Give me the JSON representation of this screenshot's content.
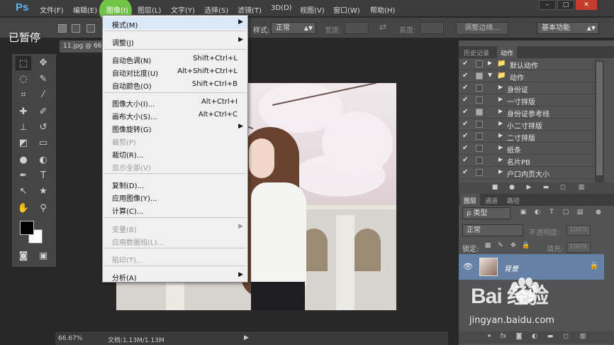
{
  "watermark_paused": "已暂停",
  "menubar": {
    "logo": "Ps",
    "items": [
      "文件(F)",
      "编辑(E)",
      "图像(I)",
      "图层(L)",
      "文字(Y)",
      "选择(S)",
      "滤镜(T)",
      "3D(D)",
      "视图(V)",
      "窗口(W)",
      "帮助(H)"
    ],
    "window_buttons": [
      "–",
      "□",
      "✕"
    ]
  },
  "options": {
    "style_label": "样式:",
    "style_value": "正常",
    "width_label": "宽度:",
    "height_label": "高度:",
    "refine_button": "调整边缘...",
    "workspace": "基本功能"
  },
  "document": {
    "tab_title": "11.jpg @ 66",
    "zoom": "66.67%",
    "doc_size": "文档:1.13M/1.13M",
    "status_arrow": "▶"
  },
  "image_menu": {
    "items": [
      {
        "label": "模式(M)",
        "shortcut": "",
        "submenu": true,
        "disabled": false,
        "highlight": true
      },
      {
        "label": "调整(J)",
        "shortcut": "",
        "submenu": true,
        "disabled": false
      },
      {
        "label": "自动色调(N)",
        "shortcut": "Shift+Ctrl+L",
        "disabled": false
      },
      {
        "label": "自动对比度(U)",
        "shortcut": "Alt+Shift+Ctrl+L",
        "disabled": false
      },
      {
        "label": "自动颜色(O)",
        "shortcut": "Shift+Ctrl+B",
        "disabled": false
      },
      {
        "label": "图像大小(I)...",
        "shortcut": "Alt+Ctrl+I",
        "disabled": false
      },
      {
        "label": "画布大小(S)...",
        "shortcut": "Alt+Ctrl+C",
        "disabled": false
      },
      {
        "label": "图像旋转(G)",
        "shortcut": "",
        "submenu": true,
        "disabled": false
      },
      {
        "label": "裁剪(P)",
        "shortcut": "",
        "disabled": true
      },
      {
        "label": "裁切(R)...",
        "shortcut": "",
        "disabled": false
      },
      {
        "label": "显示全部(V)",
        "shortcut": "",
        "disabled": true
      },
      {
        "label": "复制(D)...",
        "shortcut": "",
        "disabled": false
      },
      {
        "label": "应用图像(Y)...",
        "shortcut": "",
        "disabled": false
      },
      {
        "label": "计算(C)...",
        "shortcut": "",
        "disabled": false
      },
      {
        "label": "变量(B)",
        "shortcut": "",
        "submenu": true,
        "disabled": true
      },
      {
        "label": "应用数据组(L)...",
        "shortcut": "",
        "disabled": true
      },
      {
        "label": "陷印(T)...",
        "shortcut": "",
        "disabled": true
      },
      {
        "label": "分析(A)",
        "shortcut": "",
        "submenu": true,
        "disabled": false
      }
    ]
  },
  "actions_panel": {
    "tabs": [
      "历史记录",
      "动作"
    ],
    "rows": [
      {
        "label": "默认动作",
        "expanded": false,
        "folder": true,
        "dialog": false
      },
      {
        "label": "动作",
        "expanded": true,
        "folder": true,
        "dialog": true
      },
      {
        "label": "身份证",
        "dialog": false
      },
      {
        "label": "一寸排版",
        "dialog": false
      },
      {
        "label": "身份证参考线",
        "dialog": true
      },
      {
        "label": "小二寸排版",
        "dialog": false
      },
      {
        "label": "二寸排版",
        "dialog": false
      },
      {
        "label": "纸条",
        "dialog": false
      },
      {
        "label": "名片PB",
        "dialog": false
      },
      {
        "label": "户口内页大小",
        "dialog": false
      }
    ]
  },
  "layers_panel": {
    "tabs": [
      "图层",
      "通道",
      "路径"
    ],
    "filter_value": "ρ 类型",
    "blend_mode": "正常",
    "opacity_label": "不透明度:",
    "opacity_value": "100%",
    "lock_label": "锁定:",
    "fill_label": "填充:",
    "fill_value": "100%",
    "layer_name": "背景"
  },
  "brand": {
    "baidu_text": "Bai  经验",
    "baidu_url": "jingyan.baidu.com"
  }
}
